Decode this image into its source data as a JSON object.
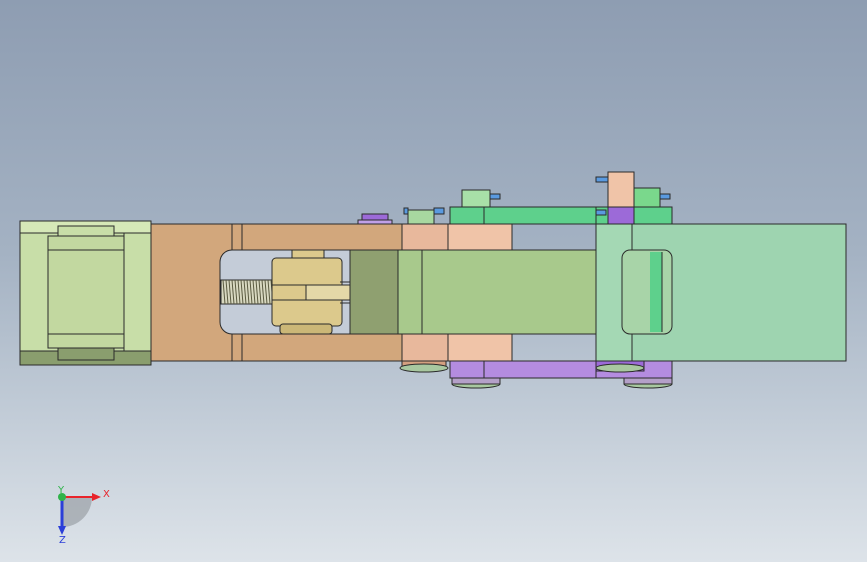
{
  "triad": {
    "x_label": "X",
    "y_label": "Y",
    "z_label": "Z",
    "colors": {
      "x": "#e8232b",
      "y": "#2fb34a",
      "z": "#2b3fd8"
    }
  },
  "colors": {
    "housing": "#c8dea8",
    "housing_dark": "#8a9e6e",
    "frame": "#d2a77c",
    "screw": "#8f9a70",
    "nut": "#dcc98c",
    "rod": "#a8c98c",
    "pink_link": "#f0c4a8",
    "green_link": "#5ed08c",
    "purple_link": "#b48ce0",
    "arm": "#9ed4b0",
    "outline": "#2a2a2a"
  }
}
